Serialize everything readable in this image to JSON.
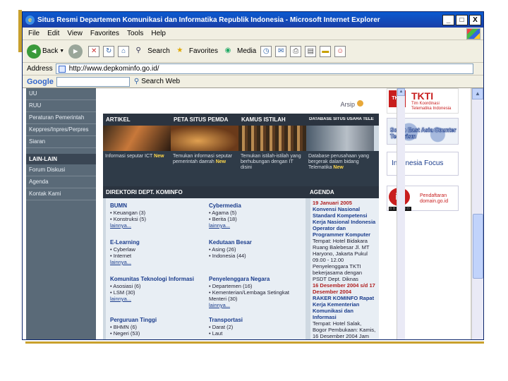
{
  "window": {
    "title": "Situs Resmi Departemen Komunikasi dan Informatika Republik Indonesia - Microsoft Internet Explorer",
    "controls": {
      "minimize": "_",
      "maximize": "□",
      "close": "X"
    }
  },
  "menu": [
    "File",
    "Edit",
    "View",
    "Favorites",
    "Tools",
    "Help"
  ],
  "toolbar": {
    "back": "Back",
    "search": "Search",
    "favorites": "Favorites",
    "media": "Media"
  },
  "address": {
    "label": "Address",
    "url": "http://www.depkominfo.go.id/"
  },
  "google": {
    "label": "Google",
    "search_label": "Search Web"
  },
  "sidebar": {
    "items": [
      "UU",
      "RUU",
      "Peraturan Pemerintah",
      "Keppres/Inpres/Perpres",
      "Siaran"
    ],
    "header": "LAIN-LAIN",
    "items2": [
      "Forum Diskusi",
      "Agenda",
      "Kontak Kami"
    ]
  },
  "top": {
    "arsip": "Arsip"
  },
  "banner": [
    "ARTIKEL",
    "PETA SITUS PEMDA",
    "KAMUS ISTILAH",
    "DATABASE SITUS USAHA TELEMATIKA"
  ],
  "blurbs": [
    {
      "text": "Informasi seputar ICT",
      "new": "New"
    },
    {
      "text": "Temukan informasi seputar pemerintah daerah",
      "new": "New"
    },
    {
      "text": "Temukan istilah-istilah yang berhubungan dengan IT disini",
      "new": ""
    },
    {
      "text": "Database perusahaan yang bergerak dalam bidang Telematika",
      "new": "New"
    }
  ],
  "sections": {
    "directory": "DIREKTORI DEPT. KOMINFO",
    "agenda": "AGENDA"
  },
  "directory": [
    {
      "title": "BUMN",
      "items": [
        "• Keuangan (3)",
        "• Konstruksi (5)"
      ],
      "more": "lainnya..."
    },
    {
      "title": "Cybermedia",
      "items": [
        "• Agama (5)",
        "• Berita (18)"
      ],
      "more": "lainnya..."
    },
    {
      "title": "E-Learning",
      "items": [
        "• Cyberlaw",
        "• Internet"
      ],
      "more": "lainnya..."
    },
    {
      "title": "Kedutaan Besar",
      "items": [
        "• Asing (26)",
        "• Indonesia (44)"
      ],
      "more": ""
    },
    {
      "title": "Komunitas Teknologi Informasi",
      "items": [
        "• Asosiasi (6)",
        "• LSM (30)"
      ],
      "more": "lainnya..."
    },
    {
      "title": "Penyelenggara Negara",
      "items": [
        "• Departemen (16)",
        "• Kementerian/Lembaga Setingkat Menteri (30)"
      ],
      "more": "lainnya..."
    },
    {
      "title": "Perguruan Tinggi",
      "items": [
        "• BHMN (6)",
        "• Negeri (53)"
      ],
      "more": ""
    },
    {
      "title": "Transportasi",
      "items": [
        "• Darat (2)",
        "• Laut"
      ],
      "more": ""
    }
  ],
  "agenda": {
    "date1": "19 Januari 2005",
    "event1": "Konvensi Nasional Standard Kompetensi Kerja Nasional Indonesia Operator dan Programmer Komputer",
    "detail1": "Tempat: Hotel Bidakara Ruang Balebesar Jl. MT Haryono, Jakarta Pukul 09.00 - 12.00 Penyelenggara TKTI bekerjasama dengan PSDT Dept. Diknas",
    "date2": "16 Desember 2004 s/d 17 Desember 2004",
    "event2": "RAKER KOMINFO Rapat Kerja Kementerian Komunikasi dan Informasi",
    "detail2": "Tempat: Hotel Salak, Bogor Pembukaan: Kamis, 16 Desember 2004 Jam"
  },
  "ads": {
    "tkti_logo": "TKTI",
    "tkti": "TKTI",
    "tkti_sub": "Tim Koordinasi Telematika Indonesia",
    "sea": "South East Asia Counter Terrorism",
    "focus": "Indonesia Focus",
    "id_logo": "id",
    "id_label": "Pendaftaran domain.go.id",
    "id_dots": "□□□□□□"
  },
  "colors": {
    "titlebar": "#0a5ad0",
    "sidebar": "#5a6a78",
    "banner": "#2b3440",
    "accent": "#c8a02c"
  }
}
